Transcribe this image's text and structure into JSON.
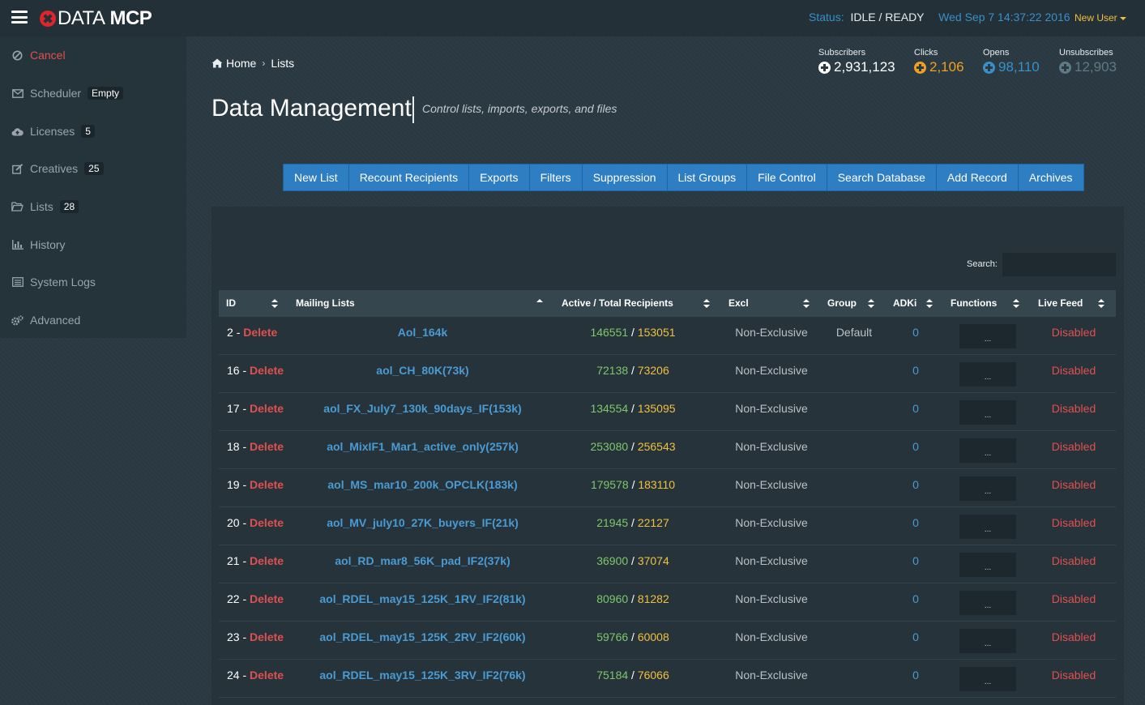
{
  "brand": {
    "part1": "DATA",
    "part2": "MCP"
  },
  "status": {
    "label": "Status:",
    "value": "IDLE / READY",
    "datetime": "Wed Sep 7 14:37:22 2016"
  },
  "user": {
    "label": "New User"
  },
  "sidebar": {
    "items": [
      {
        "label": "Cancel",
        "badge": ""
      },
      {
        "label": "Scheduler",
        "badge": "Empty"
      },
      {
        "label": "Licenses",
        "badge": "5"
      },
      {
        "label": "Creatives",
        "badge": "25"
      },
      {
        "label": "Lists",
        "badge": "28"
      },
      {
        "label": "History",
        "badge": ""
      },
      {
        "label": "System Logs",
        "badge": ""
      },
      {
        "label": "Advanced",
        "badge": ""
      }
    ]
  },
  "breadcrumb": {
    "home": "Home",
    "current": "Lists"
  },
  "page": {
    "title": "Data Management",
    "subtitle": "Control lists, imports, exports, and files"
  },
  "stats": [
    {
      "label": "Subscribers",
      "value": "2,931,123",
      "color": "#ffffff"
    },
    {
      "label": "Clicks",
      "value": "2,106",
      "color": "#f0a020"
    },
    {
      "label": "Opens",
      "value": "98,110",
      "color": "#3a8fc7"
    },
    {
      "label": "Unsubscribes",
      "value": "12,903",
      "color": "#5e7a85"
    }
  ],
  "tabs": [
    "New List",
    "Recount Recipients",
    "Exports",
    "Filters",
    "Suppression",
    "List Groups",
    "File Control",
    "Search Database",
    "Add Record",
    "Archives"
  ],
  "search": {
    "label": "Search:",
    "value": ""
  },
  "table": {
    "headers": [
      "ID",
      "Mailing Lists",
      "Active / Total Recipients",
      "Excl",
      "Group",
      "ADKi",
      "Functions",
      "Live Feed"
    ],
    "rows": [
      {
        "id": "2",
        "sep": "-",
        "delete": "Delete",
        "list": "Aol_164k",
        "active": "146551",
        "slash": "/",
        "total": "153051",
        "excl": "Non-Exclusive",
        "group": "Default",
        "adki": "0",
        "fn": "...",
        "live": "Disabled"
      },
      {
        "id": "16",
        "sep": "-",
        "delete": "Delete",
        "list": "aol_CH_80K(73k)",
        "active": "72138",
        "slash": "/",
        "total": "73206",
        "excl": "Non-Exclusive",
        "group": "",
        "adki": "0",
        "fn": "...",
        "live": "Disabled"
      },
      {
        "id": "17",
        "sep": "-",
        "delete": "Delete",
        "list": "aol_FX_July7_130k_90days_IF(153k)",
        "active": "134554",
        "slash": "/",
        "total": "135095",
        "excl": "Non-Exclusive",
        "group": "",
        "adki": "0",
        "fn": "...",
        "live": "Disabled"
      },
      {
        "id": "18",
        "sep": "-",
        "delete": "Delete",
        "list": "aol_MixIF1_Mar1_active_only(257k)",
        "active": "253080",
        "slash": "/",
        "total": "256543",
        "excl": "Non-Exclusive",
        "group": "",
        "adki": "0",
        "fn": "...",
        "live": "Disabled"
      },
      {
        "id": "19",
        "sep": "-",
        "delete": "Delete",
        "list": "aol_MS_mar10_200k_OPCLK(183k)",
        "active": "179578",
        "slash": "/",
        "total": "183110",
        "excl": "Non-Exclusive",
        "group": "",
        "adki": "0",
        "fn": "...",
        "live": "Disabled"
      },
      {
        "id": "20",
        "sep": "-",
        "delete": "Delete",
        "list": "aol_MV_july10_27K_buyers_IF(21k)",
        "active": "21945",
        "slash": "/",
        "total": "22127",
        "excl": "Non-Exclusive",
        "group": "",
        "adki": "0",
        "fn": "...",
        "live": "Disabled"
      },
      {
        "id": "21",
        "sep": "-",
        "delete": "Delete",
        "list": "aol_RD_mar8_56K_pad_IF2(37k)",
        "active": "36900",
        "slash": "/",
        "total": "37074",
        "excl": "Non-Exclusive",
        "group": "",
        "adki": "0",
        "fn": "...",
        "live": "Disabled"
      },
      {
        "id": "22",
        "sep": "-",
        "delete": "Delete",
        "list": "aol_RDEL_may15_125K_1RV_IF2(81k)",
        "active": "80960",
        "slash": "/",
        "total": "81282",
        "excl": "Non-Exclusive",
        "group": "",
        "adki": "0",
        "fn": "...",
        "live": "Disabled"
      },
      {
        "id": "23",
        "sep": "-",
        "delete": "Delete",
        "list": "aol_RDEL_may15_125K_2RV_IF2(60k)",
        "active": "59766",
        "slash": "/",
        "total": "60008",
        "excl": "Non-Exclusive",
        "group": "",
        "adki": "0",
        "fn": "...",
        "live": "Disabled"
      },
      {
        "id": "24",
        "sep": "-",
        "delete": "Delete",
        "list": "aol_RDEL_may15_125K_3RV_IF2(76k)",
        "active": "75184",
        "slash": "/",
        "total": "76066",
        "excl": "Non-Exclusive",
        "group": "",
        "adki": "0",
        "fn": "...",
        "live": "Disabled"
      }
    ]
  }
}
